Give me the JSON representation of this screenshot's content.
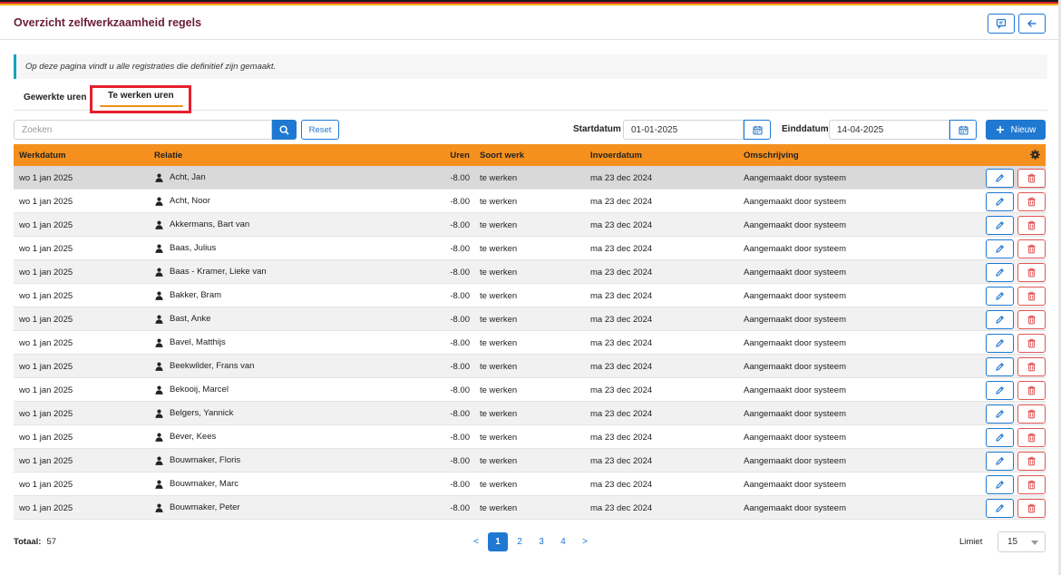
{
  "colors": {
    "stripe": [
      "#1a1a1a",
      "#d8202b",
      "#f5b21a"
    ],
    "accent": "#1f78d1",
    "header_orange": "#f5901e",
    "title_color": "#6b1d3a",
    "danger": "#e05757",
    "info_border": "#17a2b8"
  },
  "header": {
    "title": "Overzicht zelfwerkzaamheid regels",
    "chat_icon": "message-square-icon",
    "back_icon": "arrow-left-icon"
  },
  "info_text": "Op deze pagina vindt u alle registraties die definitief zijn gemaakt.",
  "tabs": [
    {
      "label": "Gewerkte uren",
      "active": false
    },
    {
      "label": "Te werken uren",
      "active": true
    }
  ],
  "filters": {
    "search_placeholder": "Zoeken",
    "search_value": "",
    "reset_label": "Reset",
    "start_label": "Startdatum",
    "start_value": "01-01-2025",
    "end_label": "Einddatum",
    "end_value": "14-04-2025",
    "new_label": "Nieuw"
  },
  "table": {
    "columns": [
      "Werkdatum",
      "Relatie",
      "Uren",
      "Soort werk",
      "Invoerdatum",
      "Omschrijving"
    ],
    "rows": [
      {
        "werkdatum": "wo 1 jan 2025",
        "relatie": "Acht, Jan",
        "uren": "-8.00",
        "soort": "te werken",
        "invoer": "ma 23 dec 2024",
        "omschrijving": "Aangemaakt door systeem"
      },
      {
        "werkdatum": "wo 1 jan 2025",
        "relatie": "Acht, Noor",
        "uren": "-8.00",
        "soort": "te werken",
        "invoer": "ma 23 dec 2024",
        "omschrijving": "Aangemaakt door systeem"
      },
      {
        "werkdatum": "wo 1 jan 2025",
        "relatie": "Akkermans, Bart van",
        "uren": "-8.00",
        "soort": "te werken",
        "invoer": "ma 23 dec 2024",
        "omschrijving": "Aangemaakt door systeem"
      },
      {
        "werkdatum": "wo 1 jan 2025",
        "relatie": "Baas, Julius",
        "uren": "-8.00",
        "soort": "te werken",
        "invoer": "ma 23 dec 2024",
        "omschrijving": "Aangemaakt door systeem"
      },
      {
        "werkdatum": "wo 1 jan 2025",
        "relatie": "Baas - Kramer, Lieke van",
        "uren": "-8.00",
        "soort": "te werken",
        "invoer": "ma 23 dec 2024",
        "omschrijving": "Aangemaakt door systeem"
      },
      {
        "werkdatum": "wo 1 jan 2025",
        "relatie": "Bakker, Bram",
        "uren": "-8.00",
        "soort": "te werken",
        "invoer": "ma 23 dec 2024",
        "omschrijving": "Aangemaakt door systeem"
      },
      {
        "werkdatum": "wo 1 jan 2025",
        "relatie": "Bast, Anke",
        "uren": "-8.00",
        "soort": "te werken",
        "invoer": "ma 23 dec 2024",
        "omschrijving": "Aangemaakt door systeem"
      },
      {
        "werkdatum": "wo 1 jan 2025",
        "relatie": "Bavel, Matthijs",
        "uren": "-8.00",
        "soort": "te werken",
        "invoer": "ma 23 dec 2024",
        "omschrijving": "Aangemaakt door systeem"
      },
      {
        "werkdatum": "wo 1 jan 2025",
        "relatie": "Beekwilder, Frans van",
        "uren": "-8.00",
        "soort": "te werken",
        "invoer": "ma 23 dec 2024",
        "omschrijving": "Aangemaakt door systeem"
      },
      {
        "werkdatum": "wo 1 jan 2025",
        "relatie": "Bekooij, Marcel",
        "uren": "-8.00",
        "soort": "te werken",
        "invoer": "ma 23 dec 2024",
        "omschrijving": "Aangemaakt door systeem"
      },
      {
        "werkdatum": "wo 1 jan 2025",
        "relatie": "Belgers, Yannick",
        "uren": "-8.00",
        "soort": "te werken",
        "invoer": "ma 23 dec 2024",
        "omschrijving": "Aangemaakt door systeem"
      },
      {
        "werkdatum": "wo 1 jan 2025",
        "relatie": "Bever, Kees",
        "uren": "-8.00",
        "soort": "te werken",
        "invoer": "ma 23 dec 2024",
        "omschrijving": "Aangemaakt door systeem"
      },
      {
        "werkdatum": "wo 1 jan 2025",
        "relatie": "Bouwmaker, Floris",
        "uren": "-8.00",
        "soort": "te werken",
        "invoer": "ma 23 dec 2024",
        "omschrijving": "Aangemaakt door systeem"
      },
      {
        "werkdatum": "wo 1 jan 2025",
        "relatie": "Bouwmaker, Marc",
        "uren": "-8.00",
        "soort": "te werken",
        "invoer": "ma 23 dec 2024",
        "omschrijving": "Aangemaakt door systeem"
      },
      {
        "werkdatum": "wo 1 jan 2025",
        "relatie": "Bouwmaker, Peter",
        "uren": "-8.00",
        "soort": "te werken",
        "invoer": "ma 23 dec 2024",
        "omschrijving": "Aangemaakt door systeem"
      }
    ]
  },
  "footer": {
    "total_label": "Totaal:",
    "total_value": "57",
    "prev": "<",
    "pages": [
      "1",
      "2",
      "3",
      "4"
    ],
    "active_page": "1",
    "next": ">",
    "limit_label": "Limiet",
    "limit_value": "15"
  }
}
